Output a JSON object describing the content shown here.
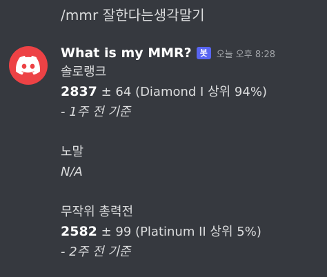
{
  "command": {
    "text": "/mmr 잘한다는생각말기"
  },
  "message": {
    "username": "What is my MMR?",
    "bot_tag": "봇",
    "timestamp": "오늘 오후 8:28",
    "avatar_icon": "discord-logo-icon",
    "avatar_color": "#ed4245",
    "sections": [
      {
        "title": "솔로랭크",
        "score": "2837",
        "detail": " ± 64 (Diamond I 상위 94%)",
        "note": "- 1주 전 기준"
      },
      {
        "title": "노말",
        "value": "N/A"
      },
      {
        "title": "무작위 총력전",
        "score": "2582",
        "detail": " ± 99 (Platinum II 상위 5%)",
        "note": "- 2주 전 기준"
      }
    ]
  },
  "colors": {
    "background": "#36393f",
    "text": "#dcddde",
    "bot_tag": "#5865f2",
    "timestamp": "#a3a6aa"
  }
}
